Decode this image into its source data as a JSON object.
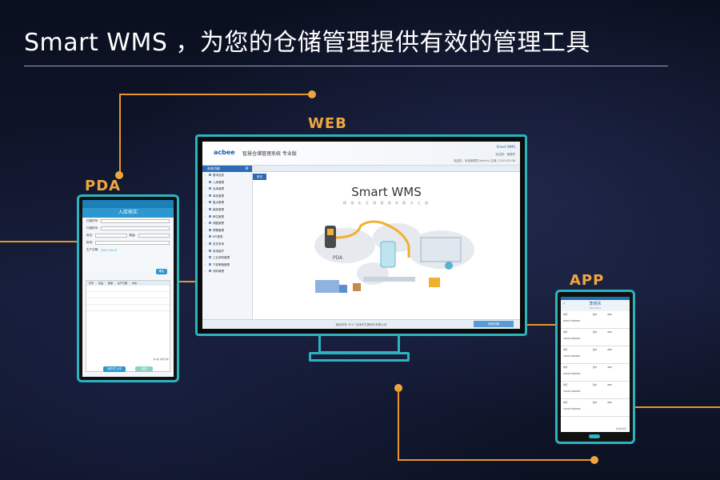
{
  "headline": "Smart WMS ，为您的仓储管理提供有效的管理工具",
  "labels": {
    "web": "WEB",
    "pda": "PDA",
    "app": "APP"
  },
  "colors": {
    "accent_orange": "#f0a640",
    "device_frame": "#2bb3c0",
    "primary_blue": "#2d6cb5",
    "background": "#0d1326"
  },
  "pda": {
    "title": "入库核实",
    "fields": [
      "扫描货号:",
      "扫描批号:",
      "库位:",
      "批号:",
      "生产日期:"
    ],
    "qty_label": "数量:",
    "date_value": "2017-09-17",
    "confirm_button": "确定",
    "table_headers": [
      "序号",
      "货品",
      "数量",
      "生产日期",
      "状态"
    ],
    "summary": "共1条 本页1条",
    "submit_button": "保存并上传",
    "return_button": "返回"
  },
  "web": {
    "brand": "acbee",
    "system_name": "智慧仓储管理系统 专业版",
    "top_link": "Smart WMS",
    "user_info": "欢迎您：管理员",
    "welcome_line": "欢迎您，系统管理员(admin) 注销 | 2019-03-06",
    "sidebar_header": "系统功能",
    "menu": [
      "基本信息",
      "入库管理",
      "出库管理",
      "库存管理",
      "盘点管理",
      "越库管理",
      "移位管理",
      "调整管理",
      "预警管理",
      "KPI报表",
      "历史查询",
      "系统维护",
      "工业采购管理",
      "下架策略管理",
      "领料管理"
    ],
    "tab_home": "首页",
    "title": "Smart WMS",
    "tagline": "精 细 化 仓 储 管 理 的 解 决 之 道",
    "illustration_pda_label": "PDA",
    "footer_text": "版权所有 2017 天津市艾蜂软件有限公司",
    "footer_button": "系统切换"
  },
  "app": {
    "title": "李晓东",
    "subtitle": "2017-10-11",
    "cards": [
      {
        "left": "单号",
        "code": "RK2017090801",
        "mid": "客户",
        "right": "(BN)"
      },
      {
        "left": "单号",
        "code": "CK2017090802",
        "mid": "客户",
        "right": "(BN)"
      },
      {
        "left": "单号",
        "code": "TK2017090803",
        "mid": "客户",
        "right": "(BN)"
      },
      {
        "left": "单号",
        "code": "CK2017090804",
        "mid": "客户",
        "right": "(BN)"
      },
      {
        "left": "单号",
        "code": "CK2017090805",
        "mid": "客户",
        "right": "(BN)"
      },
      {
        "left": "单号",
        "code": "CK2017090806",
        "mid": "客户",
        "right": "(BN)"
      }
    ],
    "footer": "共6条记录"
  }
}
